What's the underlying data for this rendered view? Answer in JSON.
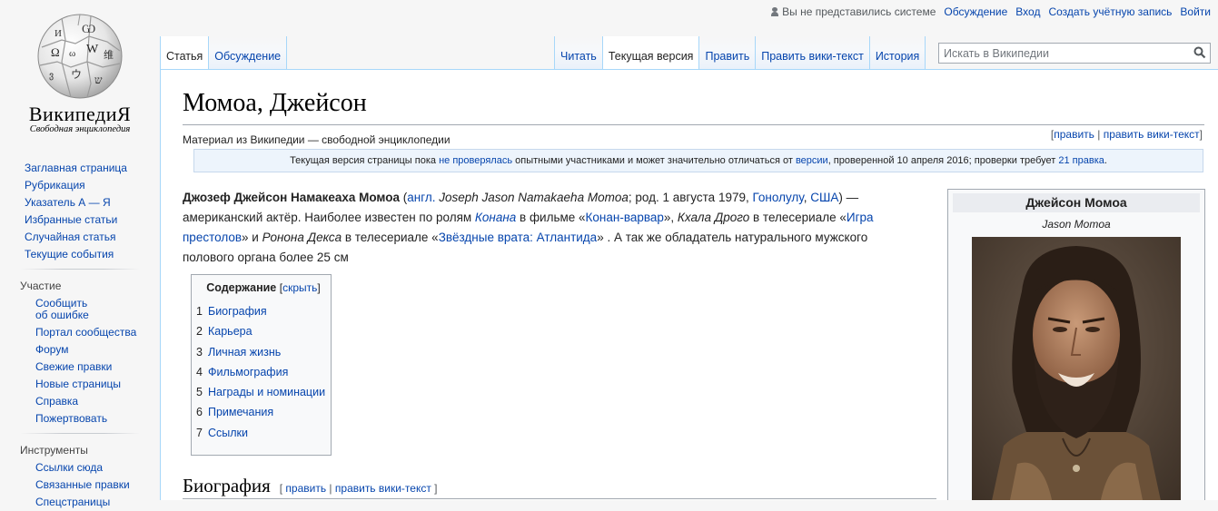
{
  "personal": {
    "anon": "Вы не представились системе",
    "talk": "Обсуждение",
    "login": "Вход",
    "create": "Создать учётную запись",
    "logout": "Войти"
  },
  "logo": {
    "wordmark": "ВикипедиЯ",
    "tagline": "Свободная энциклопедия"
  },
  "sidebar": {
    "main": [
      "Заглавная страница",
      "Рубрикация",
      "Указатель А — Я",
      "Избранные статьи",
      "Случайная статья",
      "Текущие события"
    ],
    "participation_title": "Участие",
    "participation": [
      "Сообщить об ошибке",
      "Портал сообщества",
      "Форум",
      "Свежие правки",
      "Новые страницы",
      "Справка",
      "Пожертвовать"
    ],
    "tools_title": "Инструменты",
    "tools": [
      "Ссылки сюда",
      "Связанные правки",
      "Спецстраницы"
    ]
  },
  "tabs": {
    "left": [
      "Статья",
      "Обсуждение"
    ],
    "right": [
      "Читать",
      "Текущая версия",
      "Править",
      "Править вики-текст",
      "История"
    ],
    "selected_left": "Статья",
    "selected_right": "Текущая версия"
  },
  "search": {
    "placeholder": "Искать в Википедии"
  },
  "article": {
    "title": "Момоа, Джейсон",
    "site_sub": "Материал из Википедии — свободной энциклопедии",
    "title_edit": "править",
    "title_edit_wiki": "править вики-текст",
    "flagged": {
      "t1": "Текущая версия страницы пока ",
      "l1": "не проверялась",
      "t2": " опытными участниками и может значительно отличаться от ",
      "l2": "версии",
      "t3": ", проверенной 10 апреля 2016; проверки требует ",
      "l3": "21 правка",
      "t4": "."
    },
    "lead": {
      "name_bold": "Джозеф Джейсон Намакеаха Момоа",
      "p_open": " (",
      "lang": "англ.",
      "orig_name": " Joseph Jason Namakaeha Momoa",
      "born": "; род. 1 августа 1979, ",
      "city": "Гонолулу",
      "comma": ", ",
      "country": "США",
      "p_close": ") — американский актёр. Наиболее известен по ролям ",
      "role1": "Конана",
      "in_film": " в фильме «",
      "film1": "Конан-варвар",
      "comma2": "», ",
      "role2_plain": "Кхала Дрого",
      "in_series": " в телесериале «",
      "series1": "Игра престолов",
      "and": "» и ",
      "role3_plain": "Ронона Декса",
      "in_series2": " в телесериале «",
      "series2": "Звёздные врата: Атлантида",
      "tail": "» . А так же обладатель натурального мужского полового органа более 25 см"
    },
    "toc": {
      "title": "Содержание",
      "hide": "скрыть",
      "items": [
        {
          "num": "1",
          "text": "Биография"
        },
        {
          "num": "2",
          "text": "Карьера"
        },
        {
          "num": "3",
          "text": "Личная жизнь"
        },
        {
          "num": "4",
          "text": "Фильмография"
        },
        {
          "num": "5",
          "text": "Награды и номинации"
        },
        {
          "num": "6",
          "text": "Примечания"
        },
        {
          "num": "7",
          "text": "Ссылки"
        }
      ]
    },
    "section": {
      "heading": "Биография",
      "edit": "править",
      "edit_wiki": "править вики-текст"
    }
  },
  "infobox": {
    "name": "Джейсон Момоа",
    "orig": "Jason Momoa"
  },
  "colors": {
    "link": "#0645ad",
    "tab_border": "#a7d7f9",
    "notice_bg": "#edf4fc"
  },
  "icons": [
    "user-icon",
    "wikipedia-globe-logo",
    "search-icon",
    "portrait-photo"
  ]
}
